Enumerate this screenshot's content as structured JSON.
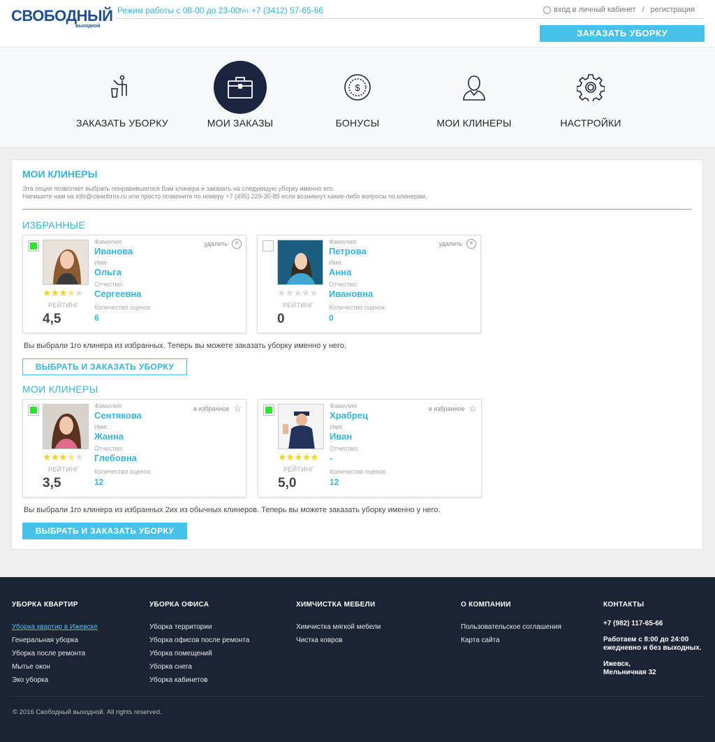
{
  "header": {
    "logo_main": "СВОБОДНЫЙ",
    "logo_sub": "выходной",
    "work_hours": "Режим работы с 08-00 до 23-00",
    "phone_label": "Тел.",
    "phone": "+7 (3412) 57-65-66",
    "login": "вход в личный кабинет",
    "separator": "/",
    "register": "регистрация",
    "order_button": "ЗАКАЗАТЬ УБОРКУ"
  },
  "nav": {
    "items": [
      {
        "label": "ЗАКАЗАТЬ УБОРКУ",
        "icon": "cleaning-icon",
        "active": false
      },
      {
        "label": "МОИ ЗАКАЗЫ",
        "icon": "briefcase-icon",
        "active": true
      },
      {
        "label": "БОНУСЫ",
        "icon": "dollar-coin-icon",
        "active": false
      },
      {
        "label": "МОИ КЛИНЕРЫ",
        "icon": "person-icon",
        "active": false
      },
      {
        "label": "НАСТРОЙКИ",
        "icon": "gear-icon",
        "active": false
      }
    ]
  },
  "panel": {
    "title": "МОИ КЛИНЕРЫ",
    "desc_line1": "Эта опция позволяет выбрать понравившегося Вам клинера и заказать на следующую уборку именно его.",
    "desc_line2": "Напишите нам на info@cleanbros.ru или просто позвоните по номеру +7 (495) 229-30-89 если возникнут какие-либо вопросы по клинерам."
  },
  "labels": {
    "surname": "Фамилия:",
    "name": "Имя:",
    "patronymic": "Отчество:",
    "ratings_count": "Количество оценок:",
    "rating": "РЕЙТИНГ"
  },
  "favorites": {
    "title": "ИЗБРАННЫЕ",
    "action_label": "удалить",
    "cards": [
      {
        "surname": "Иванова",
        "name": "Ольга",
        "patronymic": "Сергеевна",
        "rating": "4,5",
        "stars": 3.5,
        "count": "6",
        "checked": true
      },
      {
        "surname": "Петрова",
        "name": "Анна",
        "patronymic": "Ивановна",
        "rating": "0",
        "stars": 0,
        "count": "0",
        "checked": false
      }
    ],
    "note": "Вы выбрали 1го клинера из избранных. Теперь вы можете заказать уборку именно у него.",
    "button": "ВЫБРАТЬ И ЗАКАЗАТЬ УБОРКУ"
  },
  "my_cleaners": {
    "title": "МОИ КЛИНЕРЫ",
    "action_label": "в избранное",
    "cards": [
      {
        "surname": "Сентякова",
        "name": "Жанна",
        "patronymic": "Глебовна",
        "rating": "3,5",
        "stars": 3.5,
        "count": "12",
        "checked": true
      },
      {
        "surname": "Храбрец",
        "name": "Иван",
        "patronymic": "-",
        "rating": "5,0",
        "stars": 5,
        "count": "12",
        "checked": true
      }
    ],
    "note": "Вы выбрали 1го клинера из избранных  2их из обычных клинеров. Теперь вы можете заказать уборку именно у него.",
    "button": "ВЫБРАТЬ И ЗАКАЗАТЬ УБОРКУ"
  },
  "footer": {
    "col1": {
      "title": "УБОРКА КВАРТИР",
      "links": [
        "Уборка квартир в Ижевске",
        "Генеральная уборка",
        "Уборка после ремонта",
        "Мытье окон",
        "Эко уборка"
      ]
    },
    "col2": {
      "title": "УБОРКА ОФИСА",
      "links": [
        "Уборка территории",
        "Уборка офисов после ремонта",
        "Уборка помещений",
        "Уборка снега",
        "Уборка кабинетов"
      ]
    },
    "col3": {
      "title": "ХИМЧИСТКА МЕБЕЛИ",
      "links": [
        "Химчистка мягкой мебели",
        "Чистка ковров"
      ]
    },
    "col4": {
      "title": "О КОМПАНИИ",
      "links": [
        "Пользовательское соглашения",
        "Карта сайта"
      ]
    },
    "col5": {
      "title": "КОНТАКТЫ",
      "phone": "+7 (982) 117-65-66",
      "hours_line1": "Работаем с 8:00 до 24:00",
      "hours_line2": "ежедневно и без выходных.",
      "addr_line1": "Ижевск,",
      "addr_line2": "Мельничная 32"
    },
    "copyright": "© 2016 Свободный выходной. All rights reserved."
  },
  "colors": {
    "accent": "#45c1ea",
    "dark": "#1b2540",
    "footer_bg": "#1c2335",
    "star": "#f5d22a",
    "check": "#2de52d"
  }
}
